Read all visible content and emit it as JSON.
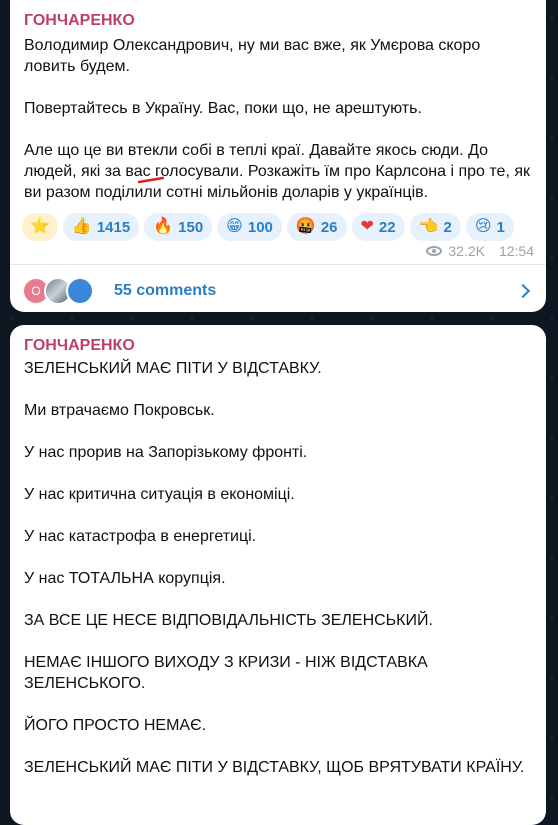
{
  "post1": {
    "author": "ГОНЧАРЕНКО",
    "paragraphs": [
      "Володимир Олександрович, ну ми вас вже, як Умєрова скоро ловить будем.",
      "Повертайтесь в Україну. Вас, поки що, не арештують.",
      "Але що це ви втекли собі в теплі краї. Давайте якось сюди. До людей, які за вас голосували. Розкажіть їм про Карлсона і про те, як ви разом поділили сотні мільйонів доларів у українців."
    ],
    "reactions": [
      {
        "icon": "star",
        "emoji": "⭐",
        "count": ""
      },
      {
        "icon": "thumbs-up",
        "emoji": "👍",
        "count": "1415"
      },
      {
        "icon": "fire",
        "emoji": "🔥",
        "count": "150"
      },
      {
        "icon": "grin",
        "emoji": "😁",
        "count": "100"
      },
      {
        "icon": "angry-face",
        "emoji": "🤬",
        "count": "26"
      },
      {
        "icon": "heart",
        "emoji": "❤",
        "count": "22"
      },
      {
        "icon": "pointing-hand",
        "emoji": "👈",
        "count": "2"
      },
      {
        "icon": "crying-face",
        "emoji": "😢",
        "count": "1"
      }
    ],
    "views": "32.2K",
    "time": "12:54",
    "comments_label": "55 comments",
    "avatar_letter": "О"
  },
  "post2": {
    "author": "ГОНЧАРЕНКО",
    "paragraphs": [
      "ЗЕЛЕНСЬКИЙ МАЄ ПІТИ У ВІДСТАВКУ.",
      "Ми втрачаємо Покровськ.",
      "У нас прорив на Запорізькому фронті.",
      "У нас критична ситуація в економіці.",
      "У нас катастрофа в енергетиці.",
      "У нас ТОТАЛЬНА корупція.",
      "ЗА ВСЕ ЦЕ НЕСЕ ВІДПОВІДАЛЬНІСТЬ ЗЕЛЕНСЬКИЙ.",
      "НЕМАЄ ІНШОГО ВИХОДУ З КРИЗИ - НІЖ ВІДСТАВКА ЗЕЛЕНСЬКОГО.",
      "ЙОГО ПРОСТО НЕМАЄ.",
      "ЗЕЛЕНСЬКИЙ МАЄ ПІТИ У ВІДСТАВКУ, ЩОБ ВРЯТУВАТИ КРАЇНУ."
    ]
  },
  "colors": {
    "author": "#c03d6f",
    "accent": "#2a7fc4",
    "background": "#0e1621"
  }
}
